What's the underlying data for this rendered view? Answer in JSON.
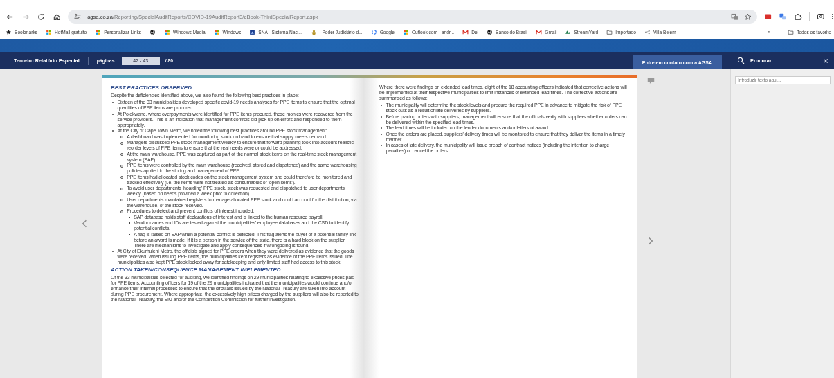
{
  "browser": {
    "forward_disabled": true,
    "url": {
      "host": "agsa.co.za",
      "path": "/Reporting/SpecialAuditReports/COVID-19AuditReport3/eBook-ThirdSpecialReport.aspx"
    },
    "bookmarks": [
      {
        "kind": "star",
        "label": "Bookmarks"
      },
      {
        "kind": "grid",
        "label": "HotMail gratuito"
      },
      {
        "kind": "grid",
        "label": "Personalizar Links"
      },
      {
        "kind": "globe"
      },
      {
        "kind": "grid",
        "label": "Windows Media"
      },
      {
        "kind": "grid",
        "label": "Windows"
      },
      {
        "kind": "square",
        "label": "SNA - Sistema Naci..."
      },
      {
        "kind": "emblem",
        "label": ": Poder Judiciário d..."
      },
      {
        "kind": "ring",
        "label": "Google"
      },
      {
        "kind": "grid",
        "label": "Outlook.com - andr..."
      },
      {
        "kind": "mail",
        "label": "Dei"
      },
      {
        "kind": "globe",
        "label": "Banco do Brasil"
      },
      {
        "kind": "mail",
        "label": "Gmail"
      },
      {
        "kind": "wave",
        "label": "StreamYard"
      },
      {
        "kind": "folder",
        "label": "Importado"
      },
      {
        "kind": "network",
        "label": "Villa Belem"
      }
    ],
    "overflow": "»",
    "all_bookmarks": "Todos os favorito"
  },
  "viewer": {
    "title": "Terceiro Relatório Especial",
    "pages_label": "páginas:",
    "pages_value": "42 - 43",
    "pages_total": "/ 80",
    "contact_button": "Entre em contato com a AGSA",
    "search_title": "Procurar",
    "search_placeholder": "Introduzir texto aqui..."
  },
  "left_page": [
    {
      "kind": "heading",
      "text": "BEST PRACTICES OBSERVED"
    },
    {
      "kind": "para",
      "text": "Despite the deficiencies identified above, we also found the following best practices in place:"
    },
    {
      "kind": "list",
      "items": [
        {
          "text": "Sixteen of the 33 municipalities developed specific covid-19 needs analyses for PPE items to ensure that the optimal quantities of PPE items are procured."
        },
        {
          "text": "At Polokwane, where overpayments were identified for PPE items procured, these monies were recovered from the service providers. This is an indication that management controls did pick up on errors and responded to them appropriately."
        },
        {
          "text": "At the City of Cape Town Metro, we noted the following best practices around PPE stock management:",
          "children": [
            {
              "text": "A dashboard was implemented for monitoring stock on hand to ensure that supply meets demand."
            },
            {
              "text": "Managers discussed PPE stock management weekly to ensure that forward planning took into account realistic reorder levels of PPE items to ensure that the real needs were or could be addressed."
            },
            {
              "text": "At the main warehouse, PPE was captured as part of the normal stock items on the real-time stock management system (SAP)."
            },
            {
              "text": "PPE items were controlled by the main warehouse (received, stored and dispatched) and the same warehousing policies applied to the storing and management of PPE."
            },
            {
              "text": "PPE items had allocated stock codes on the stock management system and could therefore be monitored and tracked effectively (i.e. the items were not treated as consumables or 'open items')."
            },
            {
              "text": "To avoid user departments 'hoarding' PPE stock, stock was requested and dispatched to user departments weekly (based on needs provided a week prior to collection)."
            },
            {
              "text": "User departments maintained registers to manage allocated PPE stock and could account for the distribution, via the warehouse, of the stock received."
            },
            {
              "text": "Procedures to detect and prevent conflicts of interest included:",
              "children": [
                {
                  "text": "SAP database holds staff declarations of interest and is linked to the human resource payroll."
                },
                {
                  "text": "Vendor names and IDs are tested against the municipalities' employee databases and the CSD to identify potential conflicts."
                },
                {
                  "text": "A flag is raised on SAP when a potential conflict is detected. This flag alerts the buyer of a potential family link before an award is made. If it is a person in the service of the state, there is a hard block on the supplier. There are mechanisms to investigate and apply consequences if wrongdoing is found."
                }
              ]
            }
          ]
        },
        {
          "text": "At City of Ekurhuleni Metro, the officials signed for PPE orders when they were delivered as evidence that the goods were received. When issuing PPE items, the municipalities kept registers as evidence of the PPE items issued. The municipalities also kept PPE stock locked away for safekeeping and only limited staff had access to this stock."
        }
      ]
    },
    {
      "kind": "heading",
      "text": "ACTION TAKEN/CONSEQUENCE MANAGEMENT IMPLEMENTED"
    },
    {
      "kind": "para",
      "text": "Of the 33 municipalities selected for auditing, we identified findings on 29 municipalities relating to excessive prices paid for PPE items. Accounting officers for 19 of the 29 municipalities indicated that the municipalities would continue and/or enhance their internal processes to ensure that the circulars issued by the National Treasury are taken into account during PPE procurement. Where appropriate, the excessively high prices charged by the suppliers will also be reported to the National Treasury, the SIU and/or the Competition Commission for further investigation."
    }
  ],
  "right_page": [
    {
      "kind": "para",
      "text": "Where there were findings on extended lead times, eight of the 18 accounting officers indicated that corrective actions will be implemented at their respective municipalities to limit instances of extended lead times. The corrective actions are summarised as follows:"
    },
    {
      "kind": "list",
      "items": [
        {
          "text": "The municipality will determine the stock levels and procure the required PPE in advance to mitigate the risk of PPE stock-outs as a result of late deliveries by suppliers."
        },
        {
          "text": "Before placing orders with suppliers, management will ensure that the officials verify with suppliers whether orders can be delivered within the specified lead times."
        },
        {
          "text": "The lead times will be included on the tender documents and/or letters of award."
        },
        {
          "text": "Once the orders are placed, suppliers' delivery times will be monitored to ensure that they deliver the items in a timely manner."
        },
        {
          "text": "In cases of late delivery, the municipality will issue breach of contract notices (including the intention to charge penalties) or cancel the orders."
        }
      ]
    }
  ]
}
